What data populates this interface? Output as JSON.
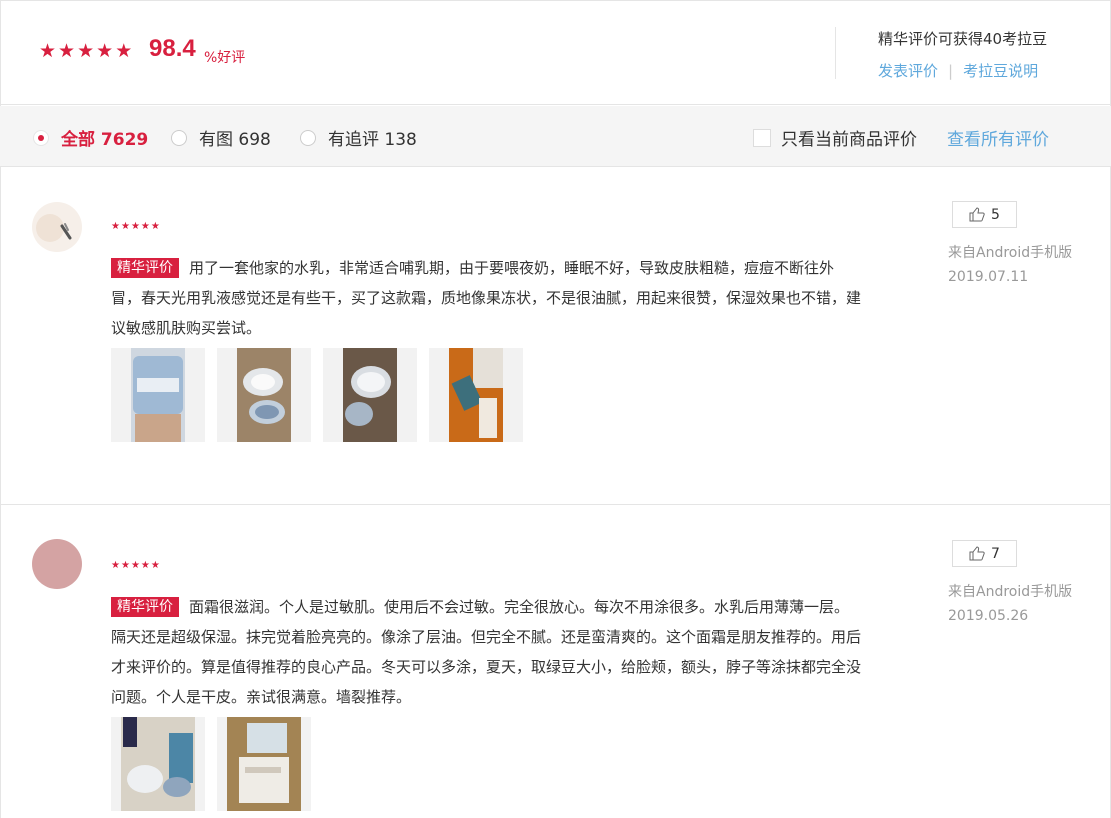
{
  "summary": {
    "rating_stars": 5,
    "rate_value": "98.4",
    "rate_unit": "%好评",
    "bonus_note": "精华评价可获得40考拉豆",
    "link_post": "发表评价",
    "link_sep": "|",
    "link_explain": "考拉豆说明"
  },
  "filters": {
    "all": "全部 7629",
    "with_image": "有图 698",
    "followup": "有追评 138",
    "current_only": "只看当前商品评价",
    "view_all": "查看所有评价"
  },
  "reviews": [
    {
      "stars": 5,
      "badge": "精华评价",
      "text": "用了一套他家的水乳，非常适合哺乳期，由于要喂夜奶，睡眠不好，导致皮肤粗糙，痘痘不断往外冒，春天光用乳液感觉还是有些干，买了这款霜，质地像果冻状，不是很油腻，用起来很赞，保湿效果也不错，建议敏感肌肤购买尝试。",
      "likes": "5",
      "source": "来自Android手机版",
      "date": "2019.07.11"
    },
    {
      "stars": 5,
      "badge": "精华评价",
      "text": "面霜很滋润。个人是过敏肌。使用后不会过敏。完全很放心。每次不用涂很多。水乳后用薄薄一层。隔天还是超级保湿。抹完觉着脸亮亮的。像涂了层油。但完全不腻。还是蛮清爽的。这个面霜是朋友推荐的。用后才来评价的。算是值得推荐的良心产品。冬天可以多涂，夏天，取绿豆大小，给脸颊，额头，脖子等涂抹都完全没问题。个人是干皮。亲试很满意。墙裂推荐。",
      "likes": "7",
      "source": "来自Android手机版",
      "date": "2019.05.26"
    }
  ],
  "colors": {
    "accent": "#d8203f",
    "link": "#5fa8dc",
    "muted": "#999999"
  }
}
